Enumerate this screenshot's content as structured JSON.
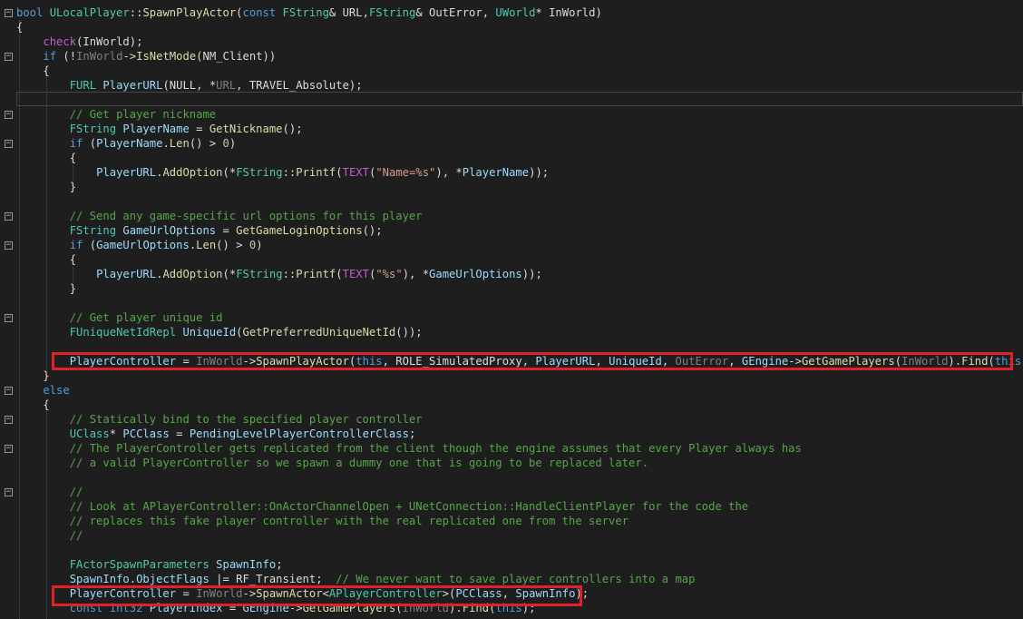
{
  "editor": {
    "language": "C++",
    "theme": "dark",
    "lines": [
      {
        "fold": "minus",
        "tokens": [
          [
            "kw",
            "bool "
          ],
          [
            "ty",
            "ULocalPlayer"
          ],
          [
            "df",
            "::"
          ],
          [
            "fn",
            "SpawnPlayActor"
          ],
          [
            "df",
            "("
          ],
          [
            "kw",
            "const "
          ],
          [
            "ty",
            "FString"
          ],
          [
            "df",
            "& URL,"
          ],
          [
            "ty",
            "FString"
          ],
          [
            "df",
            "& OutError, "
          ],
          [
            "ty",
            "UWorld"
          ],
          [
            "df",
            "* InWorld)"
          ]
        ]
      },
      {
        "fold": "",
        "tokens": [
          [
            "df",
            "{"
          ]
        ]
      },
      {
        "fold": "",
        "tokens": [
          [
            "df",
            "    "
          ],
          [
            "mac",
            "check"
          ],
          [
            "df",
            "(InWorld);"
          ]
        ]
      },
      {
        "fold": "minus",
        "tokens": [
          [
            "df",
            "    "
          ],
          [
            "kw",
            "if"
          ],
          [
            "df",
            " (!"
          ],
          [
            "par",
            "InWorld"
          ],
          [
            "df",
            "->"
          ],
          [
            "fn",
            "IsNetMode"
          ],
          [
            "df",
            "(NM_Client))"
          ]
        ]
      },
      {
        "fold": "",
        "tokens": [
          [
            "df",
            "    {"
          ]
        ]
      },
      {
        "fold": "",
        "tokens": [
          [
            "df",
            "        "
          ],
          [
            "ty",
            "FURL"
          ],
          [
            "df",
            " "
          ],
          [
            "var",
            "PlayerURL"
          ],
          [
            "df",
            "(NULL, *"
          ],
          [
            "par",
            "URL"
          ],
          [
            "df",
            ", TRAVEL_Absolute);"
          ]
        ]
      },
      {
        "fold": "",
        "tokens": [
          [
            "df",
            ""
          ]
        ]
      },
      {
        "fold": "minus",
        "tokens": [
          [
            "df",
            "        "
          ],
          [
            "cm",
            "// Get player nickname"
          ]
        ]
      },
      {
        "fold": "",
        "tokens": [
          [
            "df",
            "        "
          ],
          [
            "ty",
            "FString"
          ],
          [
            "df",
            " "
          ],
          [
            "var",
            "PlayerName"
          ],
          [
            "df",
            " = "
          ],
          [
            "fn",
            "GetNickname"
          ],
          [
            "df",
            "();"
          ]
        ]
      },
      {
        "fold": "minus",
        "tokens": [
          [
            "df",
            "        "
          ],
          [
            "kw",
            "if"
          ],
          [
            "df",
            " ("
          ],
          [
            "var",
            "PlayerName"
          ],
          [
            "df",
            "."
          ],
          [
            "fn",
            "Len"
          ],
          [
            "df",
            "() > "
          ],
          [
            "num",
            "0"
          ],
          [
            "df",
            ")"
          ]
        ]
      },
      {
        "fold": "",
        "tokens": [
          [
            "df",
            "        {"
          ]
        ]
      },
      {
        "fold": "",
        "tokens": [
          [
            "df",
            "            "
          ],
          [
            "var",
            "PlayerURL"
          ],
          [
            "df",
            "."
          ],
          [
            "fn",
            "AddOption"
          ],
          [
            "df",
            "(*"
          ],
          [
            "ty",
            "FString"
          ],
          [
            "df",
            "::"
          ],
          [
            "fn",
            "Printf"
          ],
          [
            "df",
            "("
          ],
          [
            "mac",
            "TEXT"
          ],
          [
            "df",
            "("
          ],
          [
            "str",
            "\"Name=%s\""
          ],
          [
            "df",
            "), *"
          ],
          [
            "var",
            "PlayerName"
          ],
          [
            "df",
            "));"
          ]
        ]
      },
      {
        "fold": "",
        "tokens": [
          [
            "df",
            "        }"
          ]
        ]
      },
      {
        "fold": "",
        "tokens": [
          [
            "df",
            ""
          ]
        ]
      },
      {
        "fold": "minus",
        "tokens": [
          [
            "df",
            "        "
          ],
          [
            "cm",
            "// Send any game-specific url options for this player"
          ]
        ]
      },
      {
        "fold": "",
        "tokens": [
          [
            "df",
            "        "
          ],
          [
            "ty",
            "FString"
          ],
          [
            "df",
            " "
          ],
          [
            "var",
            "GameUrlOptions"
          ],
          [
            "df",
            " = "
          ],
          [
            "fn",
            "GetGameLoginOptions"
          ],
          [
            "df",
            "();"
          ]
        ]
      },
      {
        "fold": "minus",
        "tokens": [
          [
            "df",
            "        "
          ],
          [
            "kw",
            "if"
          ],
          [
            "df",
            " ("
          ],
          [
            "var",
            "GameUrlOptions"
          ],
          [
            "df",
            "."
          ],
          [
            "fn",
            "Len"
          ],
          [
            "df",
            "() > "
          ],
          [
            "num",
            "0"
          ],
          [
            "df",
            ")"
          ]
        ]
      },
      {
        "fold": "",
        "tokens": [
          [
            "df",
            "        {"
          ]
        ]
      },
      {
        "fold": "",
        "tokens": [
          [
            "df",
            "            "
          ],
          [
            "var",
            "PlayerURL"
          ],
          [
            "df",
            "."
          ],
          [
            "fn",
            "AddOption"
          ],
          [
            "df",
            "(*"
          ],
          [
            "ty",
            "FString"
          ],
          [
            "df",
            "::"
          ],
          [
            "fn",
            "Printf"
          ],
          [
            "df",
            "("
          ],
          [
            "mac",
            "TEXT"
          ],
          [
            "df",
            "("
          ],
          [
            "str",
            "\"%s\""
          ],
          [
            "df",
            "), *"
          ],
          [
            "var",
            "GameUrlOptions"
          ],
          [
            "df",
            "));"
          ]
        ]
      },
      {
        "fold": "",
        "tokens": [
          [
            "df",
            "        }"
          ]
        ]
      },
      {
        "fold": "",
        "tokens": [
          [
            "df",
            ""
          ]
        ]
      },
      {
        "fold": "minus",
        "tokens": [
          [
            "df",
            "        "
          ],
          [
            "cm",
            "// Get player unique id"
          ]
        ]
      },
      {
        "fold": "",
        "tokens": [
          [
            "df",
            "        "
          ],
          [
            "ty",
            "FUniqueNetIdRepl"
          ],
          [
            "df",
            " "
          ],
          [
            "var",
            "UniqueId"
          ],
          [
            "df",
            "("
          ],
          [
            "fn",
            "GetPreferredUniqueNetId"
          ],
          [
            "df",
            "());"
          ]
        ]
      },
      {
        "fold": "",
        "tokens": [
          [
            "df",
            ""
          ]
        ]
      },
      {
        "fold": "",
        "tokens": [
          [
            "df",
            "        "
          ],
          [
            "var",
            "PlayerController"
          ],
          [
            "df",
            " = "
          ],
          [
            "par",
            "InWorld"
          ],
          [
            "df",
            "->"
          ],
          [
            "fn",
            "SpawnPlayActor"
          ],
          [
            "df",
            "("
          ],
          [
            "kw",
            "this"
          ],
          [
            "df",
            ", ROLE_SimulatedProxy, "
          ],
          [
            "var",
            "PlayerURL"
          ],
          [
            "df",
            ", "
          ],
          [
            "var",
            "UniqueId"
          ],
          [
            "df",
            ", "
          ],
          [
            "par",
            "OutError"
          ],
          [
            "df",
            ", "
          ],
          [
            "var",
            "GEngine"
          ],
          [
            "df",
            "->"
          ],
          [
            "fn",
            "GetGamePlayers"
          ],
          [
            "df",
            "("
          ],
          [
            "par",
            "InWorld"
          ],
          [
            "df",
            ")."
          ],
          [
            "fn",
            "Find"
          ],
          [
            "df",
            "("
          ],
          [
            "kw",
            "this"
          ],
          [
            "df",
            "));"
          ]
        ]
      },
      {
        "fold": "",
        "tokens": [
          [
            "df",
            "    }"
          ]
        ]
      },
      {
        "fold": "minus",
        "tokens": [
          [
            "df",
            "    "
          ],
          [
            "kw",
            "else"
          ]
        ]
      },
      {
        "fold": "",
        "tokens": [
          [
            "df",
            "    {"
          ]
        ]
      },
      {
        "fold": "minus",
        "tokens": [
          [
            "df",
            "        "
          ],
          [
            "cm",
            "// Statically bind to the specified player controller"
          ]
        ]
      },
      {
        "fold": "",
        "tokens": [
          [
            "df",
            "        "
          ],
          [
            "ty",
            "UClass"
          ],
          [
            "df",
            "* "
          ],
          [
            "var",
            "PCClass"
          ],
          [
            "df",
            " = "
          ],
          [
            "var",
            "PendingLevelPlayerControllerClass"
          ],
          [
            "df",
            ";"
          ]
        ]
      },
      {
        "fold": "minus",
        "tokens": [
          [
            "df",
            "        "
          ],
          [
            "cm",
            "// The PlayerController gets replicated from the client though the engine assumes that every Player always has"
          ]
        ]
      },
      {
        "fold": "",
        "tokens": [
          [
            "df",
            "        "
          ],
          [
            "cm",
            "// a valid PlayerController so we spawn a dummy one that is going to be replaced later."
          ]
        ]
      },
      {
        "fold": "",
        "tokens": [
          [
            "df",
            ""
          ]
        ]
      },
      {
        "fold": "minus",
        "tokens": [
          [
            "df",
            "        "
          ],
          [
            "cm",
            "//"
          ]
        ]
      },
      {
        "fold": "",
        "tokens": [
          [
            "df",
            "        "
          ],
          [
            "cm",
            "// Look at APlayerController::OnActorChannelOpen + UNetConnection::HandleClientPlayer for the code the"
          ]
        ]
      },
      {
        "fold": "",
        "tokens": [
          [
            "df",
            "        "
          ],
          [
            "cm",
            "// replaces this fake player controller with the real replicated one from the server"
          ]
        ]
      },
      {
        "fold": "",
        "tokens": [
          [
            "df",
            "        "
          ],
          [
            "cm",
            "//"
          ]
        ]
      },
      {
        "fold": "",
        "tokens": [
          [
            "df",
            ""
          ]
        ]
      },
      {
        "fold": "",
        "tokens": [
          [
            "df",
            "        "
          ],
          [
            "ty",
            "FActorSpawnParameters"
          ],
          [
            "df",
            " "
          ],
          [
            "var",
            "SpawnInfo"
          ],
          [
            "df",
            ";"
          ]
        ]
      },
      {
        "fold": "",
        "tokens": [
          [
            "df",
            "        "
          ],
          [
            "var",
            "SpawnInfo"
          ],
          [
            "df",
            "."
          ],
          [
            "var",
            "ObjectFlags"
          ],
          [
            "df",
            " |= RF_Transient;  "
          ],
          [
            "cm",
            "// We never want to save player controllers into a map"
          ]
        ]
      },
      {
        "fold": "",
        "tokens": [
          [
            "df",
            "        "
          ],
          [
            "var",
            "PlayerController"
          ],
          [
            "df",
            " = "
          ],
          [
            "par",
            "InWorld"
          ],
          [
            "df",
            "->"
          ],
          [
            "fn",
            "SpawnActor"
          ],
          [
            "df",
            "<"
          ],
          [
            "ty",
            "APlayerController"
          ],
          [
            "df",
            ">("
          ],
          [
            "var",
            "PCClass"
          ],
          [
            "df",
            ", "
          ],
          [
            "var",
            "SpawnInfo"
          ],
          [
            "df",
            ");"
          ]
        ]
      },
      {
        "fold": "",
        "tokens": [
          [
            "df",
            "        "
          ],
          [
            "kw",
            "const "
          ],
          [
            "kw",
            "int32"
          ],
          [
            "df",
            " "
          ],
          [
            "var",
            "PlayerIndex"
          ],
          [
            "df",
            " = "
          ],
          [
            "var",
            "GEngine"
          ],
          [
            "df",
            "->"
          ],
          [
            "fn",
            "GetGamePlayers"
          ],
          [
            "df",
            "("
          ],
          [
            "par",
            "InWorld"
          ],
          [
            "df",
            ")."
          ],
          [
            "fn",
            "Find"
          ],
          [
            "df",
            "("
          ],
          [
            "kw",
            "this"
          ],
          [
            "df",
            ");"
          ]
        ]
      }
    ]
  },
  "highlights": [
    {
      "label": "spawn-play-actor-call",
      "line": 24
    },
    {
      "label": "spawn-actor-call",
      "line": 40
    }
  ]
}
